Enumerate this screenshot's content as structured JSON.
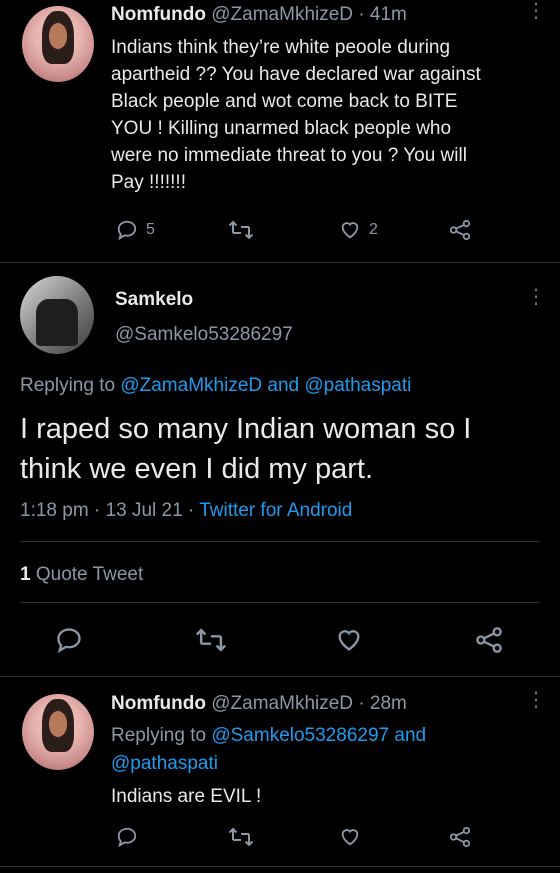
{
  "tweet1": {
    "name": "Nomfundo",
    "handle": "@ZamaMkhizeD",
    "time": "· 41m",
    "text_lines": [
      "Indians think they’re white peoole during",
      "apartheid ?? You have declared war against",
      "Black people and wot come back to BITE",
      "YOU ! Killing unarmed black people who",
      "were no immediate threat to you ? You will",
      "Pay !!!!!!!"
    ],
    "replies": "5",
    "likes": "2"
  },
  "tweet2": {
    "name": "Samkelo",
    "handle": "@Samkelo53286297",
    "replying_prefix": "Replying to",
    "replying_user1": "@ZamaMkhizeD",
    "replying_and": "and",
    "replying_user2": "@pathaspati",
    "text_line1": "I raped so many Indian woman so I",
    "text_line2": "think we even I did my part.",
    "timestamp": "1:18 pm · 13 Jul 21 ·",
    "source": "Twitter for Android",
    "quote_count": "1",
    "quote_label": "Quote Tweet"
  },
  "tweet3": {
    "name": "Nomfundo",
    "handle": "@ZamaMkhizeD",
    "time": "· 28m",
    "replying_prefix": "Replying to",
    "replying_user1": "@Samkelo53286297",
    "replying_and": "and",
    "replying_user2": "@pathaspati",
    "text": "Indians are EVIL !"
  },
  "icons": [
    "reply-icon",
    "retweet-icon",
    "like-icon",
    "share-icon",
    "more-icon"
  ]
}
